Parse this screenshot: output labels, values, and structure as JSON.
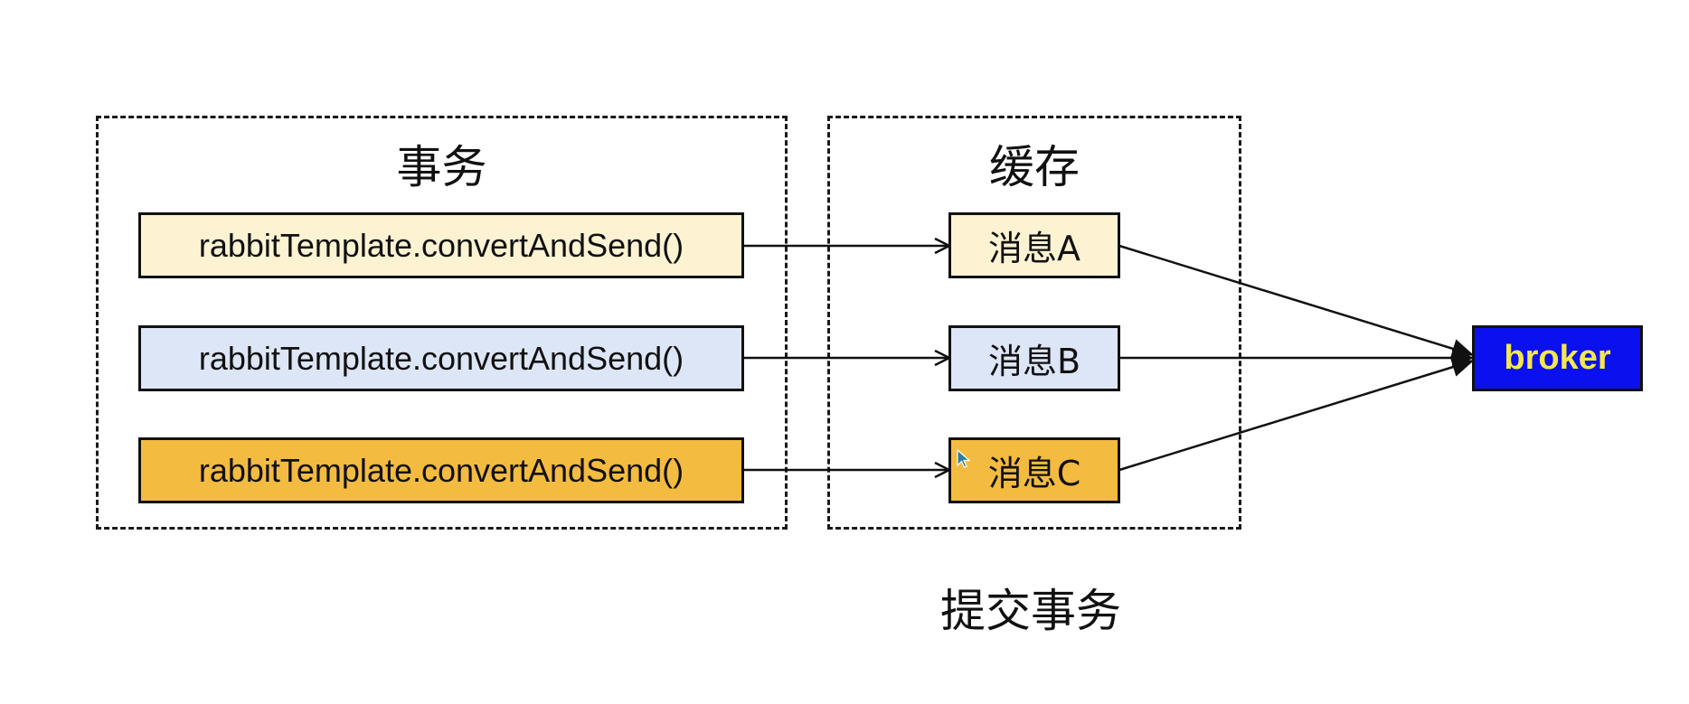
{
  "transaction_group": {
    "title": "事务"
  },
  "cache_group": {
    "title": "缓存"
  },
  "calls": [
    {
      "label": "rabbitTemplate.convertAndSend()",
      "fill": "#fdf3d2"
    },
    {
      "label": "rabbitTemplate.convertAndSend()",
      "fill": "#dde6f6"
    },
    {
      "label": "rabbitTemplate.convertAndSend()",
      "fill": "#f4bb41"
    }
  ],
  "messages": [
    {
      "label": "消息A",
      "fill": "#fdf3d2"
    },
    {
      "label": "消息B",
      "fill": "#dde6f6"
    },
    {
      "label": "消息C",
      "fill": "#f4bb41"
    }
  ],
  "broker": {
    "label": "broker",
    "fill": "#0a10ee",
    "text_color": "#f3e84a"
  },
  "footer": {
    "label": "提交事务"
  }
}
